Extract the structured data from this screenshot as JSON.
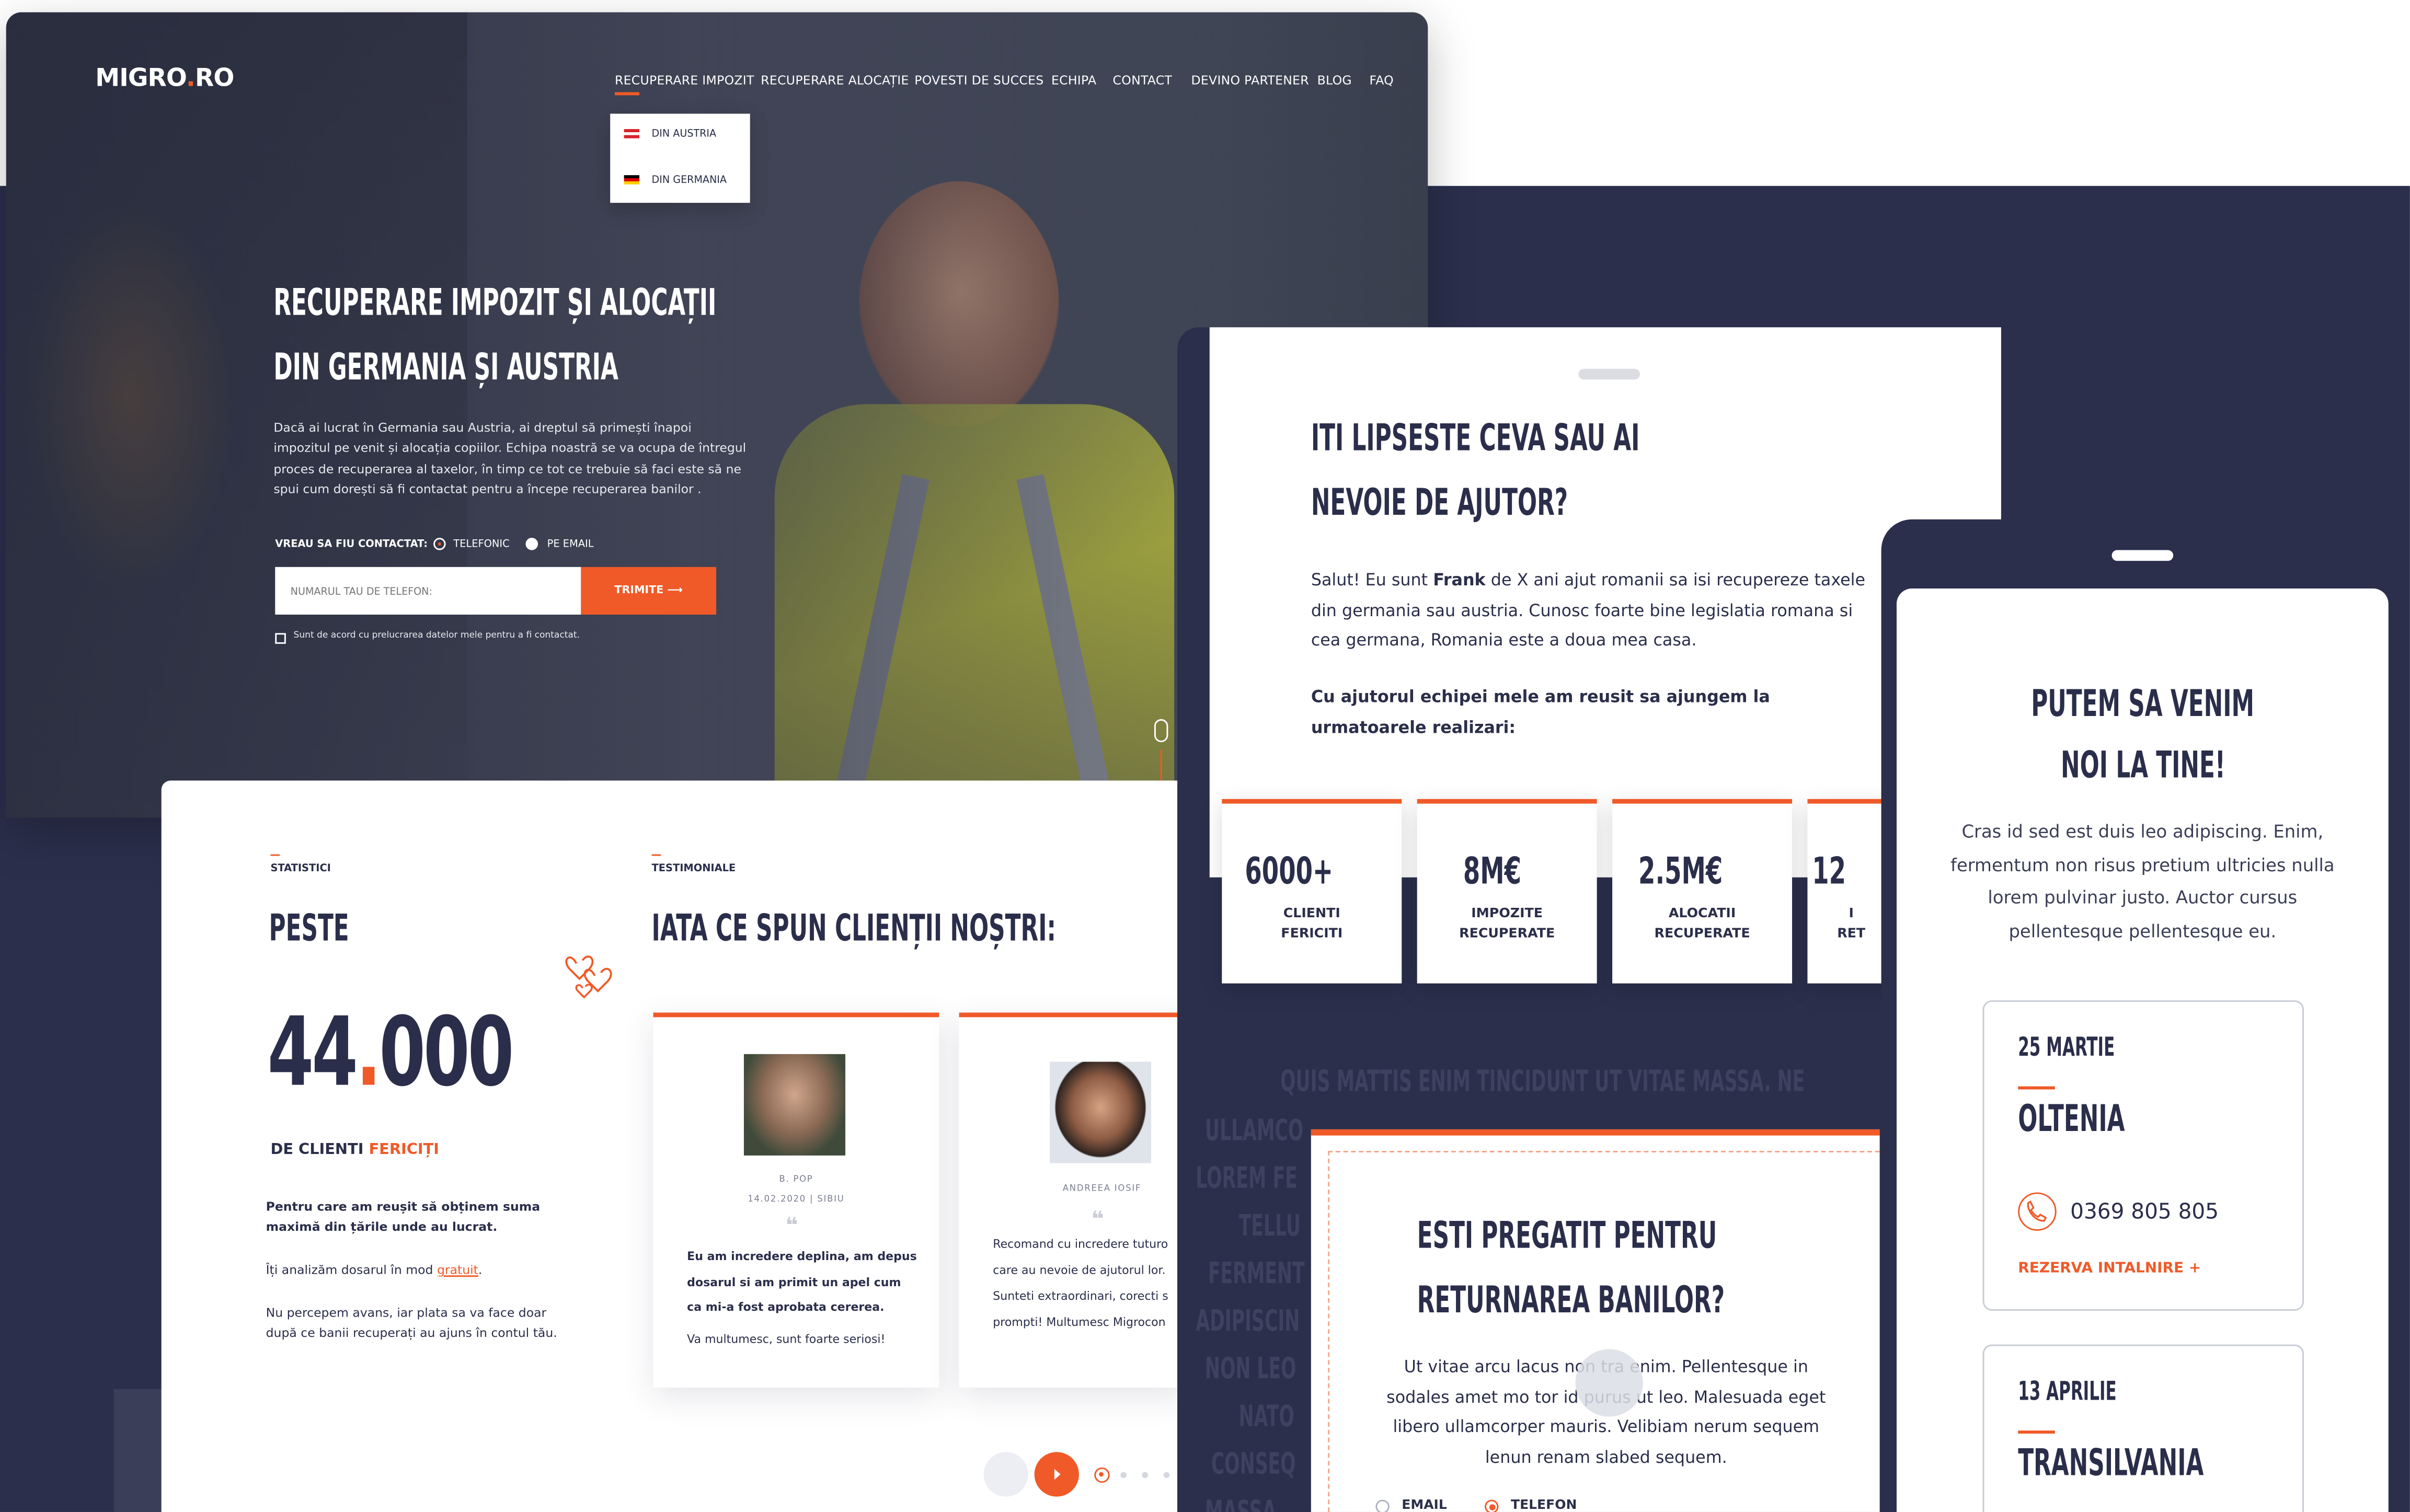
{
  "header": {
    "logo_left": "MIGRO",
    "logo_dot": ".",
    "logo_right": "RO",
    "nav": [
      "RECUPERARE IMPOZIT",
      "RECUPERARE ALOCAȚIE",
      "POVESTI DE SUCCES",
      "ECHIPA",
      "CONTACT",
      "DEVINO PARTENER",
      "BLOG",
      "FAQ"
    ],
    "dropdown": [
      "DIN AUSTRIA",
      "DIN GERMANIA"
    ]
  },
  "hero": {
    "title_line1": "RECUPERARE IMPOZIT ȘI ALOCAȚII",
    "title_line2": "DIN GERMANIA ȘI AUSTRIA",
    "description": "Dacă ai lucrat în Germania sau Austria, ai dreptul să primești înapoi impozitul pe venit și alocația copiilor. Echipa noastră se va ocupa de întregul proces de recuperarea al taxelor, în timp ce tot ce trebuie să faci  este să ne spui cum dorești să fi contactat pentru a începe recuperarea banilor .",
    "contact_label": "VREAU SA FIU CONTACTAT:",
    "option_phone": "TELEFONIC",
    "option_email": "PE EMAIL",
    "phone_placeholder": "NUMARUL TAU DE TELEFON:",
    "submit_label": "TRIMITE",
    "submit_arrow": "⟶",
    "consent": "Sunt de acord cu prelucrarea datelor mele pentru a fi contactat."
  },
  "stats": {
    "section_label": "STATISTICI",
    "peste": "PESTE",
    "number_a": "44",
    "number_dot": ".",
    "number_b": "000",
    "clienti_prefix": "DE CLIENTI",
    "clienti_highlight": "FERICIȚI",
    "p1": "Pentru care am reușit să obținem suma maximă din țările unde au lucrat.",
    "p2_prefix": "Îți analizăm dosarul în mod",
    "p2_link": "gratuit",
    "p2_suffix": ".",
    "p3": "Nu percepem avans, iar plata sa va face doar după ce banii recuperați au ajuns în contul tău."
  },
  "testimonials": {
    "section_label": "TESTIMONIALE",
    "title": "IATA CE SPUN CLIENȚII NOȘTRI:",
    "items": [
      {
        "name": "B. POP",
        "meta": "14.02.2020 | SIBIU",
        "text_bold": "Eu am incredere deplina, am depus dosarul si am primit un apel cum ca mi-a fost aprobata cererea.",
        "text": "Va multumesc, sunt foarte seriosi!"
      },
      {
        "name": "ANDREEA IOSIF",
        "meta": "",
        "text_line1": "Recomand cu incredere tuturo",
        "text_line2": "care au nevoie de ajutorul lor.",
        "text_line3": "Sunteti extraordinari, corecti s",
        "text_line4": "prompti! Multumesc Migrocon"
      }
    ],
    "quote_mark": "❝"
  },
  "help": {
    "title_line1": "ITI LIPSESTE CEVA SAU AI",
    "title_line2": "NEVOIE DE AJUTOR?",
    "p_prefix": "Salut! Eu sunt",
    "p_name": "Frank",
    "p_rest": "de X ani ajut romanii sa isi recupereze taxele din germania sau austria. Cunosc foarte bine legislatia romana si cea germana, Romania este a doua mea casa.",
    "p2": "Cu ajutorul echipei mele am reusit sa ajungem la urmatoarele realizari:",
    "stats": [
      {
        "value": "6000+",
        "label_1": "CLIENTI",
        "label_2": "FERICITI"
      },
      {
        "value": "8M€",
        "label_1": "IMPOZITE",
        "label_2": "RECUPERATE"
      },
      {
        "value": "2.5M€",
        "label_1": "ALOCATII",
        "label_2": "RECUPERATE"
      },
      {
        "value": "12",
        "label_1": "I",
        "label_2": "RET"
      }
    ]
  },
  "marquee": {
    "l1": "QUIS MATTIS ENIM TINCIDUNT UT VITAE MASSA. NE",
    "l2": "ULLAMCO",
    "l3": "LOREM FE",
    "l4": "TELLU",
    "l5": "FERMENT",
    "l6": "ADIPISCIN",
    "l7": "NON LEO",
    "l8": "NATO",
    "l9": "CONSEQ",
    "l10": "MASSA"
  },
  "ready": {
    "title_line1": "ESTI PREGATIT PENTRU",
    "title_line2": "RETURNAREA BANILOR?",
    "text": "Ut vitae arcu lacus non        tra enim. Pellentesque in sodales amet mo        tor id purus ut leo. Malesuada eget libero ullamcorper mauris. Velibiam nerum sequem lenun renam slabed sequem.",
    "opt_email": "EMAIL",
    "opt_phone": "TELEFON"
  },
  "visit": {
    "title_line1": "PUTEM SA VENIM",
    "title_line2": "NOI LA TINE!",
    "text": "Cras id sed est duis leo adipiscing. Enim, fermentum non risus pretium ultricies nulla lorem pulvinar justo. Auctor cursus pellentesque pellentesque eu.",
    "events": [
      {
        "date": "25 MARTIE",
        "region": "OLTENIA",
        "phone": "0369 805 805",
        "book": "REZERVA INTALNIRE +"
      },
      {
        "date": "13 APRILIE",
        "region": "TRANSILVANIA"
      }
    ]
  },
  "colors": {
    "accent": "#f05a28",
    "navy": "#2b2f4c",
    "ink": "#2a2e4a"
  },
  "icons": [
    "mouse-scroll-icon",
    "heart-doodle-icon",
    "phone-icon",
    "play-arrow-icon",
    "quote-icon"
  ]
}
